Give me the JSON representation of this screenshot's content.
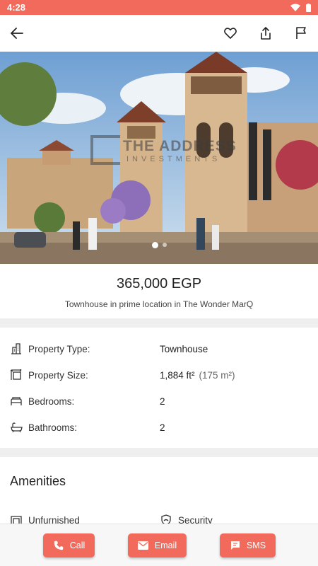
{
  "status_bar": {
    "time": "4:28"
  },
  "listing": {
    "price": "365,000 EGP",
    "subtitle": "Townhouse in prime location in The Wonder MarQ"
  },
  "image": {
    "watermark_main": "THE ADDRESS",
    "watermark_sub": "INVESTMENTS",
    "total_slides": 2,
    "active_slide": 1
  },
  "details": [
    {
      "icon": "building-icon",
      "label": "Property Type:",
      "value": "Townhouse",
      "metric": ""
    },
    {
      "icon": "size-icon",
      "label": "Property Size:",
      "value": "1,884 ft²",
      "metric": "(175 m²)"
    },
    {
      "icon": "bed-icon",
      "label": "Bedrooms:",
      "value": "2",
      "metric": ""
    },
    {
      "icon": "bath-icon",
      "label": "Bathrooms:",
      "value": "2",
      "metric": ""
    }
  ],
  "amenities": {
    "title": "Amenities",
    "items": [
      {
        "icon": "sofa-icon",
        "label": "Unfurnished"
      },
      {
        "icon": "security-icon",
        "label": "Security"
      }
    ]
  },
  "actions": {
    "call": "Call",
    "email": "Email",
    "sms": "SMS"
  },
  "colors": {
    "accent": "#f26a5b",
    "separator": "#efefef"
  }
}
